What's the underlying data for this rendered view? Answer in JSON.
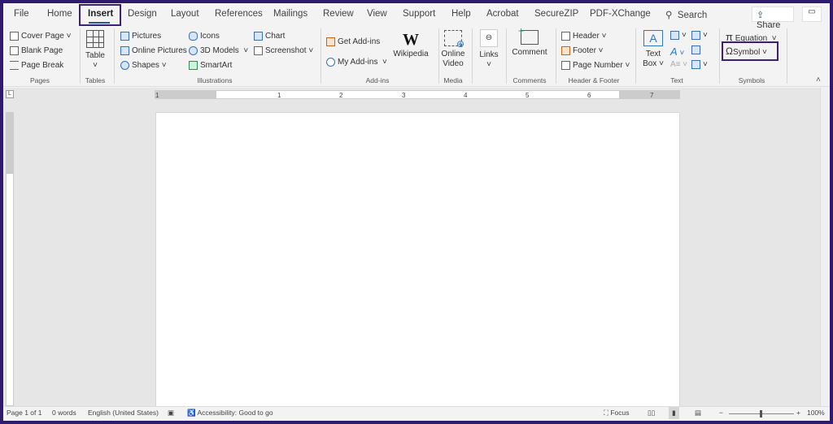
{
  "tabs": [
    "File",
    "Home",
    "Insert",
    "Design",
    "Layout",
    "References",
    "Mailings",
    "Review",
    "View",
    "Support",
    "Help",
    "Acrobat",
    "SecureZIP",
    "PDF-XChange"
  ],
  "search_label": "Search",
  "share_label": "Share",
  "pages": {
    "items": [
      "Cover Page",
      "Blank Page",
      "Page Break"
    ],
    "label": "Pages"
  },
  "tables": {
    "table": "Table",
    "label": "Tables"
  },
  "illustrations": {
    "items": [
      "Pictures",
      "Online Pictures",
      "Shapes",
      "Icons",
      "3D Models",
      "SmartArt",
      "Chart",
      "Screenshot"
    ],
    "label": "Illustrations"
  },
  "addins": {
    "get": "Get Add-ins",
    "my": "My Add-ins",
    "wiki": "Wikipedia",
    "label": "Add-ins"
  },
  "media": {
    "video1": "Online",
    "video2": "Video",
    "label": "Media"
  },
  "links": {
    "links": "Links"
  },
  "comments": {
    "comment": "Comment",
    "label": "Comments"
  },
  "headerfooter": {
    "items": [
      "Header",
      "Footer",
      "Page Number"
    ],
    "label": "Header & Footer"
  },
  "text": {
    "tb1": "Text",
    "tb2": "Box",
    "label": "Text"
  },
  "symbols": {
    "equation": "Equation",
    "symbol": "Symbol",
    "label": "Symbols"
  },
  "ruler": [
    "1",
    "1",
    "2",
    "3",
    "4",
    "5",
    "6",
    "7"
  ],
  "status": {
    "page": "Page 1 of 1",
    "words": "0 words",
    "lang": "English (United States)",
    "access": "Accessibility: Good to go",
    "focus": "Focus",
    "zoom": "100%"
  },
  "colors": {
    "frame": "#2f1b6e",
    "highlight": "#3b1f7a"
  }
}
